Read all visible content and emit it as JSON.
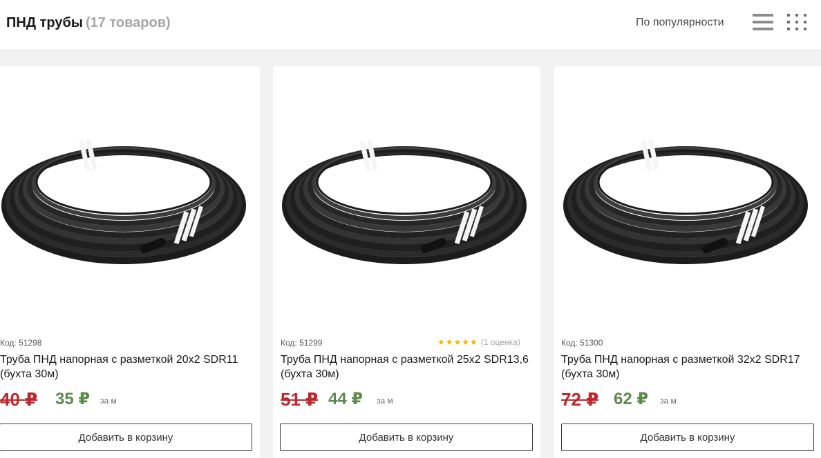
{
  "header": {
    "title": "ПНД трубы",
    "count": "(17 товаров)",
    "sort_label": "По популярности",
    "list_view_icon": "list-view-icon",
    "grid_view_icon": "grid-view-icon"
  },
  "products": [
    {
      "code": "Код: 51298",
      "name": "Труба ПНД напорная с разметкой 20х2 SDR11 (бухта 30м)",
      "old_price": "40 ₽",
      "price": "35 ₽",
      "unit": "за м",
      "button": "Добавить в корзину",
      "image_icon": "pipe-coil-image"
    },
    {
      "code": "Код: 51299",
      "rating_stars": "★★★★★",
      "rating_count": "(1 оценка)",
      "rating_value": 5,
      "name": "Труба ПНД напорная с разметкой 25х2 SDR13,6 (бухта 30м)",
      "old_price": "51 ₽",
      "price": "44 ₽",
      "unit": "за м",
      "button": "Добавить в корзину",
      "image_icon": "pipe-coil-image"
    },
    {
      "code": "Код: 51300",
      "name": "Труба ПНД напорная с разметкой 32х2 SDR17 (бухта 30м)",
      "old_price": "72 ₽",
      "price": "62 ₽",
      "unit": "за м",
      "button": "Добавить в корзину",
      "image_icon": "pipe-coil-image"
    }
  ],
  "colors": {
    "old_price": "#c0272d",
    "new_price": "#5f8a4e",
    "star": "#f1b200"
  }
}
